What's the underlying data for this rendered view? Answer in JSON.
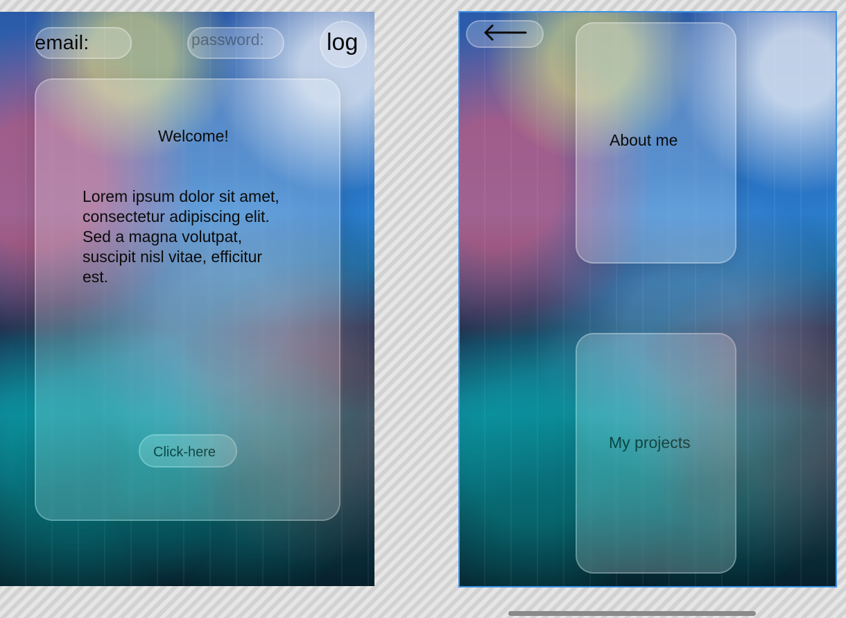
{
  "left_screen": {
    "email_label": "email:",
    "password_placeholder": "password:",
    "login_label": "log",
    "welcome_title": "Welcome!",
    "paragraph": "Lorem ipsum dolor sit amet,\nconsectetur adipiscing elit.\n Sed a magna volutpat,\nsuscipit nisl vitae, efficitur\nest.",
    "cta_label": "Click-here"
  },
  "right_screen": {
    "back_icon": "arrow-left-icon",
    "about_label": "About me",
    "projects_label": "My projects",
    "frame_outline_color": "#3b8fe5"
  }
}
